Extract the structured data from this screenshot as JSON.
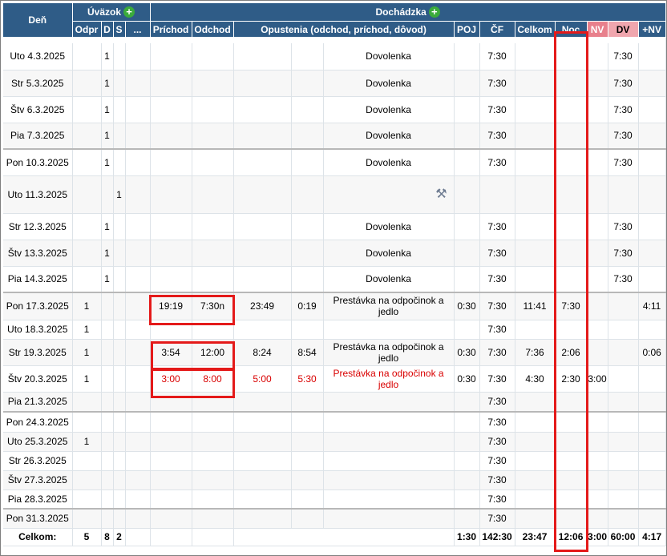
{
  "header": {
    "den": "Deň",
    "uvazok": "Úväzok",
    "dochadzka": "Dochádzka",
    "cols": {
      "odpr": "Odpr",
      "d": "D",
      "s": "S",
      "more": "...",
      "prichod": "Príchod",
      "odchod": "Odchod",
      "opustenia": "Opustenia (odchod, príchod, dôvod)",
      "poj": "POJ",
      "cf": "ČF",
      "celkom": "Celkom",
      "noc": "Noc",
      "nv": "NV",
      "dv": "DV",
      "plusnv": "+NV"
    }
  },
  "rows": [
    {
      "day": "Uto 4.3.2025",
      "odpr": "",
      "d": "1",
      "s": "",
      "prichod": "",
      "odchod": "",
      "o_out": "",
      "o_in": "",
      "reason": "Dovolenka",
      "poj": "",
      "cf": "7:30",
      "celkom": "",
      "noc": "",
      "nv": "",
      "dv": "7:30",
      "plusnv": ""
    },
    {
      "day": "Str 5.3.2025",
      "odpr": "",
      "d": "1",
      "s": "",
      "prichod": "",
      "odchod": "",
      "o_out": "",
      "o_in": "",
      "reason": "Dovolenka",
      "poj": "",
      "cf": "7:30",
      "celkom": "",
      "noc": "",
      "nv": "",
      "dv": "7:30",
      "plusnv": ""
    },
    {
      "day": "Štv 6.3.2025",
      "odpr": "",
      "d": "1",
      "s": "",
      "prichod": "",
      "odchod": "",
      "o_out": "",
      "o_in": "",
      "reason": "Dovolenka",
      "poj": "",
      "cf": "7:30",
      "celkom": "",
      "noc": "",
      "nv": "",
      "dv": "7:30",
      "plusnv": ""
    },
    {
      "day": "Pia 7.3.2025",
      "odpr": "",
      "d": "1",
      "s": "",
      "prichod": "",
      "odchod": "",
      "o_out": "",
      "o_in": "",
      "reason": "Dovolenka",
      "poj": "",
      "cf": "7:30",
      "celkom": "",
      "noc": "",
      "nv": "",
      "dv": "7:30",
      "plusnv": ""
    },
    {
      "day": "Pon 10.3.2025",
      "odpr": "",
      "d": "1",
      "s": "",
      "prichod": "",
      "odchod": "",
      "o_out": "",
      "o_in": "",
      "reason": "Dovolenka",
      "poj": "",
      "cf": "7:30",
      "celkom": "",
      "noc": "",
      "nv": "",
      "dv": "7:30",
      "plusnv": ""
    },
    {
      "day": "Uto 11.3.2025",
      "odpr": "",
      "d": "",
      "s": "1",
      "prichod": "",
      "odchod": "",
      "o_out": "",
      "o_in": "",
      "reason": "",
      "poj": "",
      "cf": "",
      "celkom": "",
      "noc": "",
      "nv": "",
      "dv": "",
      "plusnv": ""
    },
    {
      "day": "Str 12.3.2025",
      "odpr": "",
      "d": "1",
      "s": "",
      "prichod": "",
      "odchod": "",
      "o_out": "",
      "o_in": "",
      "reason": "Dovolenka",
      "poj": "",
      "cf": "7:30",
      "celkom": "",
      "noc": "",
      "nv": "",
      "dv": "7:30",
      "plusnv": ""
    },
    {
      "day": "Štv 13.3.2025",
      "odpr": "",
      "d": "1",
      "s": "",
      "prichod": "",
      "odchod": "",
      "o_out": "",
      "o_in": "",
      "reason": "Dovolenka",
      "poj": "",
      "cf": "7:30",
      "celkom": "",
      "noc": "",
      "nv": "",
      "dv": "7:30",
      "plusnv": ""
    },
    {
      "day": "Pia 14.3.2025",
      "odpr": "",
      "d": "1",
      "s": "",
      "prichod": "",
      "odchod": "",
      "o_out": "",
      "o_in": "",
      "reason": "Dovolenka",
      "poj": "",
      "cf": "7:30",
      "celkom": "",
      "noc": "",
      "nv": "",
      "dv": "7:30",
      "plusnv": ""
    },
    {
      "day": "Pon 17.3.2025",
      "odpr": "1",
      "d": "",
      "s": "",
      "prichod": "19:19",
      "odchod": "7:30n",
      "o_out": "23:49",
      "o_in": "0:19",
      "reason": "Prestávka na odpočinok a jedlo",
      "poj": "0:30",
      "cf": "7:30",
      "celkom": "11:41",
      "noc": "7:30",
      "nv": "",
      "dv": "",
      "plusnv": "4:11"
    },
    {
      "day": "Uto 18.3.2025",
      "odpr": "1",
      "d": "",
      "s": "",
      "prichod": "",
      "odchod": "",
      "o_out": "",
      "o_in": "",
      "reason": "",
      "poj": "",
      "cf": "7:30",
      "celkom": "",
      "noc": "",
      "nv": "",
      "dv": "",
      "plusnv": ""
    },
    {
      "day": "Str 19.3.2025",
      "odpr": "1",
      "d": "",
      "s": "",
      "prichod": "3:54",
      "odchod": "12:00",
      "o_out": "8:24",
      "o_in": "8:54",
      "reason": "Prestávka na odpočinok a jedlo",
      "poj": "0:30",
      "cf": "7:30",
      "celkom": "7:36",
      "noc": "2:06",
      "nv": "",
      "dv": "",
      "plusnv": "0:06"
    },
    {
      "day": "Štv 20.3.2025",
      "odpr": "1",
      "d": "",
      "s": "",
      "prichod": "3:00",
      "odchod": "8:00",
      "o_out": "5:00",
      "o_in": "5:30",
      "reason": "Prestávka na odpočinok a jedlo",
      "poj": "0:30",
      "cf": "7:30",
      "celkom": "4:30",
      "noc": "2:30",
      "nv": "3:00",
      "dv": "",
      "plusnv": ""
    },
    {
      "day": "Pia 21.3.2025",
      "odpr": "",
      "d": "",
      "s": "",
      "prichod": "",
      "odchod": "",
      "o_out": "",
      "o_in": "",
      "reason": "",
      "poj": "",
      "cf": "7:30",
      "celkom": "",
      "noc": "",
      "nv": "",
      "dv": "",
      "plusnv": ""
    },
    {
      "day": "Pon 24.3.2025",
      "odpr": "",
      "d": "",
      "s": "",
      "prichod": "",
      "odchod": "",
      "o_out": "",
      "o_in": "",
      "reason": "",
      "poj": "",
      "cf": "7:30",
      "celkom": "",
      "noc": "",
      "nv": "",
      "dv": "",
      "plusnv": ""
    },
    {
      "day": "Uto 25.3.2025",
      "odpr": "1",
      "d": "",
      "s": "",
      "prichod": "",
      "odchod": "",
      "o_out": "",
      "o_in": "",
      "reason": "",
      "poj": "",
      "cf": "7:30",
      "celkom": "",
      "noc": "",
      "nv": "",
      "dv": "",
      "plusnv": ""
    },
    {
      "day": "Str 26.3.2025",
      "odpr": "",
      "d": "",
      "s": "",
      "prichod": "",
      "odchod": "",
      "o_out": "",
      "o_in": "",
      "reason": "",
      "poj": "",
      "cf": "7:30",
      "celkom": "",
      "noc": "",
      "nv": "",
      "dv": "",
      "plusnv": ""
    },
    {
      "day": "Štv 27.3.2025",
      "odpr": "",
      "d": "",
      "s": "",
      "prichod": "",
      "odchod": "",
      "o_out": "",
      "o_in": "",
      "reason": "",
      "poj": "",
      "cf": "7:30",
      "celkom": "",
      "noc": "",
      "nv": "",
      "dv": "",
      "plusnv": ""
    },
    {
      "day": "Pia 28.3.2025",
      "odpr": "",
      "d": "",
      "s": "",
      "prichod": "",
      "odchod": "",
      "o_out": "",
      "o_in": "",
      "reason": "",
      "poj": "",
      "cf": "7:30",
      "celkom": "",
      "noc": "",
      "nv": "",
      "dv": "",
      "plusnv": ""
    },
    {
      "day": "Pon 31.3.2025",
      "odpr": "",
      "d": "",
      "s": "",
      "prichod": "",
      "odchod": "",
      "o_out": "",
      "o_in": "",
      "reason": "",
      "poj": "",
      "cf": "7:30",
      "celkom": "",
      "noc": "",
      "nv": "",
      "dv": "",
      "plusnv": ""
    }
  ],
  "total": {
    "label": "Celkom:",
    "odpr": "5",
    "d": "8",
    "s": "2",
    "poj": "1:30",
    "cf": "142:30",
    "celkom": "23:47",
    "noc": "12:06",
    "nv": "3:00",
    "dv": "60:00",
    "plusnv": "4:17"
  },
  "icons": {
    "add": "plus-circle-icon",
    "tools": "tools-icon"
  },
  "colors": {
    "header_bg": "#2f5c87",
    "nv_header_bg": "#e8808c",
    "dv_header_bg": "#f0a6ae",
    "add_icon": "#3bab3b",
    "highlight_border": "#e41a1a",
    "error_text": "#d90000"
  }
}
